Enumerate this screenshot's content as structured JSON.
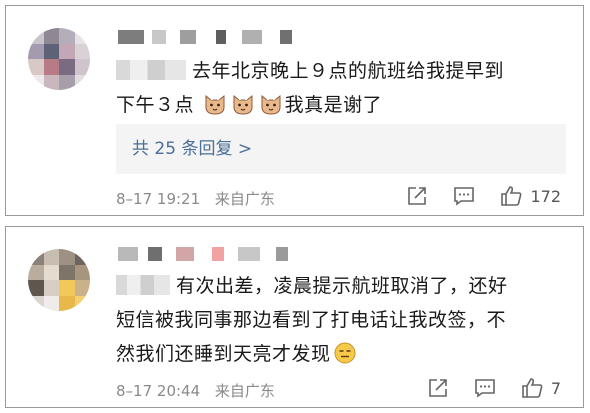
{
  "comments": [
    {
      "content_lines": [
        "去年北京晚上９点的航班给我提早到",
        "下午３点"
      ],
      "content_tail": "我真是谢了",
      "reply_label": "共 25 条回复 >",
      "time": "8–17 19:21",
      "location": "来自广东",
      "like_count": "172",
      "icons": [
        "cat-emoji",
        "share-icon",
        "comment-icon",
        "like-icon"
      ]
    },
    {
      "content_lines": [
        "有次出差，凌晨提示航班取消了，还好",
        "短信被我同事那边看到了打电话让我改签，不",
        "然我们还睡到天亮才发现"
      ],
      "time": "8–17 20:44",
      "location": "来自广东",
      "like_count": "7",
      "icons": [
        "sweat-emoji",
        "share-icon",
        "comment-icon",
        "like-icon"
      ]
    }
  ],
  "colors": {
    "link": "#4a6f98",
    "meta": "#8a8a8a",
    "border": "#9a9a9a",
    "reply_bg": "#f4f4f4"
  }
}
